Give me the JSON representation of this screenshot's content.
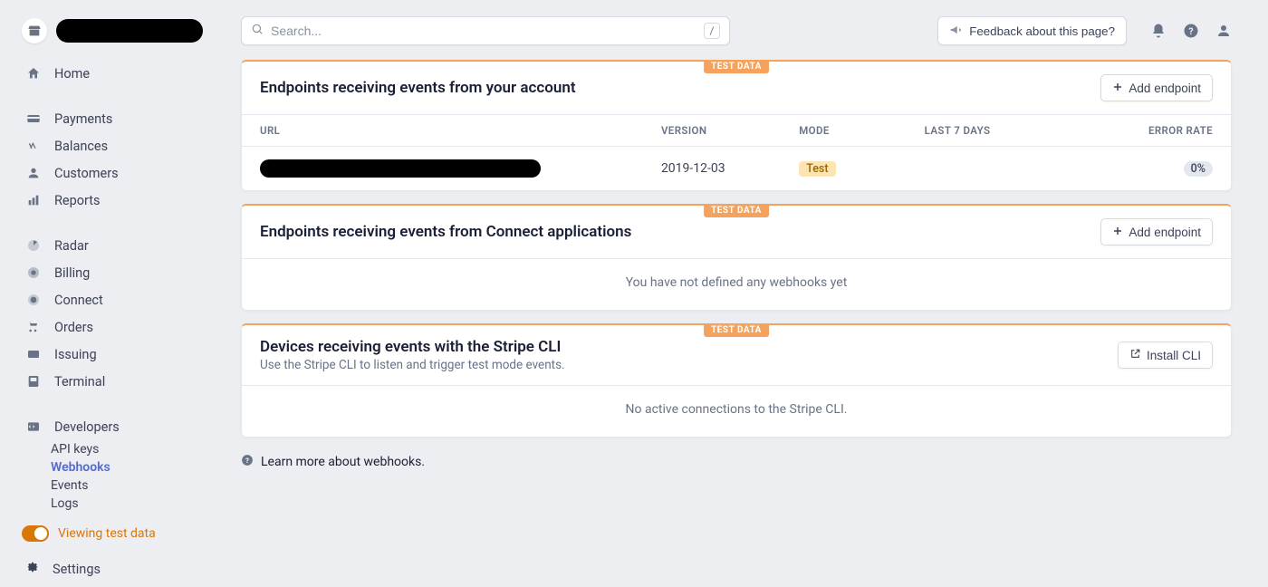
{
  "brand": {
    "account_name": "████████"
  },
  "search": {
    "placeholder": "Search...",
    "shortcut": "/"
  },
  "top": {
    "feedback": "Feedback about this page?"
  },
  "nav": {
    "home": "Home",
    "payments": "Payments",
    "balances": "Balances",
    "customers": "Customers",
    "reports": "Reports",
    "radar": "Radar",
    "billing": "Billing",
    "connect": "Connect",
    "orders": "Orders",
    "issuing": "Issuing",
    "terminal": "Terminal",
    "developers": "Developers",
    "api_keys": "API keys",
    "webhooks": "Webhooks",
    "events": "Events",
    "logs": "Logs",
    "test_mode": "Viewing test data",
    "settings": "Settings"
  },
  "chips": {
    "test_data": "TEST DATA"
  },
  "card1": {
    "title": "Endpoints receiving events from your account",
    "action": "Add endpoint",
    "columns": {
      "url": "URL",
      "version": "VERSION",
      "mode": "MODE",
      "last7": "LAST 7 DAYS",
      "error": "ERROR RATE"
    },
    "row": {
      "url": "████████████████████████",
      "version": "2019-12-03",
      "mode": "Test",
      "last7": "",
      "error": "0%"
    }
  },
  "card2": {
    "title": "Endpoints receiving events from Connect applications",
    "action": "Add endpoint",
    "empty": "You have not defined any webhooks yet"
  },
  "card3": {
    "title": "Devices receiving events with the Stripe CLI",
    "subtitle": "Use the Stripe CLI to listen and trigger test mode events.",
    "action": "Install CLI",
    "empty": "No active connections to the Stripe CLI."
  },
  "footer": {
    "learn_more": "Learn more about webhooks."
  }
}
